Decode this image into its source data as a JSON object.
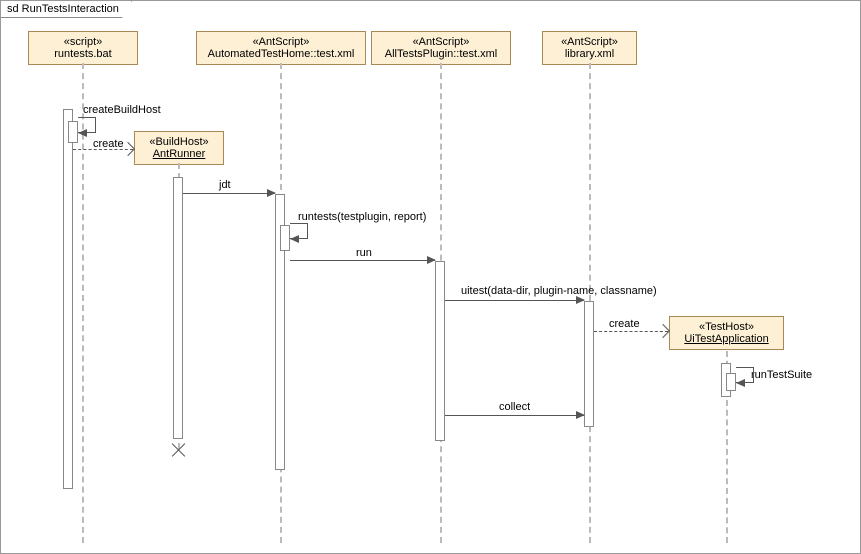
{
  "frame": {
    "title": "sd RunTestsInteraction"
  },
  "lifelines": {
    "runtests": {
      "stereo": "«script»",
      "name": "runtests.bat"
    },
    "automated": {
      "stereo": "«AntScript»",
      "name": "AutomatedTestHome::test.xml"
    },
    "alltests": {
      "stereo": "«AntScript»",
      "name": "AllTestsPlugin::test.xml"
    },
    "library": {
      "stereo": "«AntScript»",
      "name": "library.xml"
    },
    "antrunner": {
      "stereo": "«BuildHost»",
      "name": "AntRunner"
    },
    "uitestapp": {
      "stereo": "«TestHost»",
      "name": "UiTestApplication"
    }
  },
  "messages": {
    "createBuildHost": "createBuildHost",
    "create": "create",
    "jdt": "jdt",
    "runtests": "runtests(testplugin, report)",
    "run": "run",
    "uitest": "uitest(data-dir, plugin-name, classname)",
    "create2": "create",
    "runTestSuite": "runTestSuite",
    "collect": "collect"
  }
}
